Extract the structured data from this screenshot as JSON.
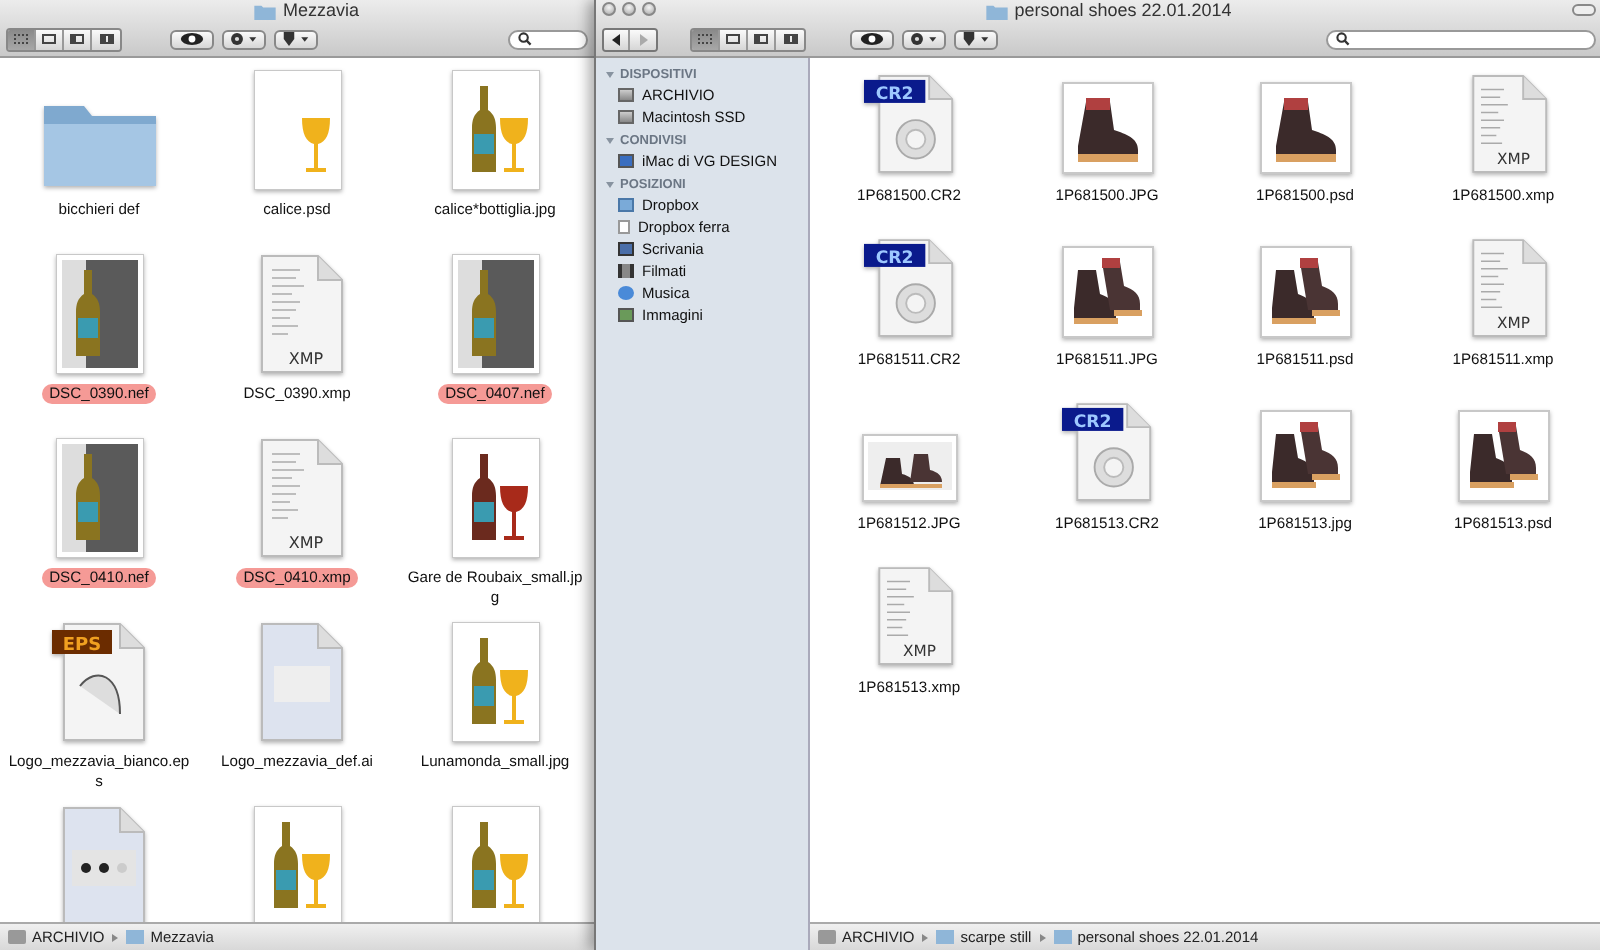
{
  "left_window": {
    "title": "Mezzavia",
    "view_modes": [
      {
        "kind": "icons",
        "selected": true
      },
      {
        "kind": "list",
        "selected": false
      },
      {
        "kind": "columns",
        "selected": false
      },
      {
        "kind": "coverflow",
        "selected": false
      }
    ],
    "files": [
      {
        "name": "bicchieri def",
        "kind": "folder"
      },
      {
        "name": "calice.psd",
        "kind": "photo-glass"
      },
      {
        "name": "calice*bottiglia.jpg",
        "kind": "photo-bottle-glass"
      },
      {
        "name": "DSC_0390.nef",
        "kind": "photo-bottle",
        "color": "#f59a96"
      },
      {
        "name": "DSC_0390.xmp",
        "kind": "xmp",
        "icon_label": "XMP"
      },
      {
        "name": "DSC_0407.nef",
        "kind": "photo-bottle",
        "color": "#f59a96"
      },
      {
        "name": "DSC_0410.nef",
        "kind": "photo-bottle",
        "color": "#f59a96"
      },
      {
        "name": "DSC_0410.xmp",
        "kind": "xmp",
        "icon_label": "XMP",
        "color": "#f59a96"
      },
      {
        "name": "Gare de Roubaix_small.jpg",
        "kind": "photo-bottle-glass-red"
      },
      {
        "name": "Logo_mezzavia_bianco.eps",
        "kind": "eps",
        "icon_label": "EPS"
      },
      {
        "name": "Logo_mezzavia_def.ai",
        "kind": "ai"
      },
      {
        "name": "Lunamonda_small.jpg",
        "kind": "photo-bottle-glass"
      },
      {
        "kind": "ai-dots"
      },
      {
        "kind": "photo-bottle-glass"
      },
      {
        "kind": "photo-bottle-glass"
      }
    ],
    "path": [
      {
        "kind": "drive",
        "label": "ARCHIVIO"
      },
      {
        "kind": "folder",
        "label": "Mezzavia"
      }
    ]
  },
  "right_window": {
    "title": "personal shoes 22.01.2014",
    "view_modes": [
      {
        "kind": "icons",
        "selected": true
      },
      {
        "kind": "list",
        "selected": false
      },
      {
        "kind": "columns",
        "selected": false
      },
      {
        "kind": "coverflow",
        "selected": false
      }
    ],
    "sidebar": {
      "sections": [
        {
          "heading": "DISPOSITIVI",
          "expanded": true,
          "items": [
            {
              "label": "ARCHIVIO",
              "kind": "drive"
            },
            {
              "label": "Macintosh SSD",
              "kind": "drive"
            }
          ]
        },
        {
          "heading": "CONDIVISI",
          "expanded": true,
          "items": [
            {
              "label": "iMac di VG DESIGN",
              "kind": "monitor"
            }
          ]
        },
        {
          "heading": "POSIZIONI",
          "expanded": true,
          "items": [
            {
              "label": "Dropbox",
              "kind": "box-folder"
            },
            {
              "label": "Dropbox ferra",
              "kind": "document"
            },
            {
              "label": "Scrivania",
              "kind": "desktop"
            },
            {
              "label": "Filmati",
              "kind": "film"
            },
            {
              "label": "Musica",
              "kind": "music"
            },
            {
              "label": "Immagini",
              "kind": "picture"
            }
          ]
        }
      ]
    },
    "files": [
      {
        "name": "1P681500.CR2",
        "kind": "cr2",
        "icon_label": "CR2"
      },
      {
        "name": "1P681500.JPG",
        "kind": "photo-boot"
      },
      {
        "name": "1P681500.psd",
        "kind": "photo-boot"
      },
      {
        "name": "1P681500.xmp",
        "kind": "xmp",
        "icon_label": "XMP"
      },
      {
        "name": "1P681511.CR2",
        "kind": "cr2",
        "icon_label": "CR2"
      },
      {
        "name": "1P681511.JPG",
        "kind": "photo-boots"
      },
      {
        "name": "1P681511.psd",
        "kind": "photo-boots"
      },
      {
        "name": "1P681511.xmp",
        "kind": "xmp",
        "icon_label": "XMP"
      },
      {
        "name": "1P681512.JPG",
        "kind": "photo-boots-wide"
      },
      {
        "name": "1P681513.CR2",
        "kind": "cr2",
        "icon_label": "CR2"
      },
      {
        "name": "1P681513.jpg",
        "kind": "photo-boots"
      },
      {
        "name": "1P681513.psd",
        "kind": "photo-boots"
      },
      {
        "name": "1P681513.xmp",
        "kind": "xmp",
        "icon_label": "XMP"
      }
    ],
    "path": [
      {
        "kind": "drive",
        "label": "ARCHIVIO"
      },
      {
        "kind": "folder",
        "label": "scarpe still"
      },
      {
        "kind": "folder",
        "label": "personal shoes 22.01.2014"
      }
    ]
  }
}
